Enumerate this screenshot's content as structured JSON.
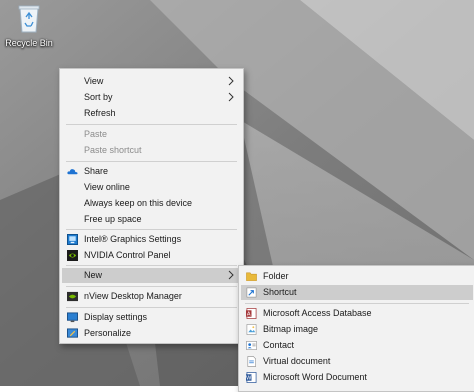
{
  "desktop": {
    "recycle_bin_label": "Recycle Bin"
  },
  "context_menu": {
    "view": "View",
    "sort_by": "Sort by",
    "refresh": "Refresh",
    "paste": "Paste",
    "paste_shortcut": "Paste shortcut",
    "share": "Share",
    "view_online": "View online",
    "always_keep": "Always keep on this device",
    "free_up_space": "Free up space",
    "intel_graphics": "Intel® Graphics Settings",
    "nvidia_panel": "NVIDIA Control Panel",
    "new": "New",
    "nview": "nView Desktop Manager",
    "display_settings": "Display settings",
    "personalize": "Personalize"
  },
  "new_submenu": {
    "folder": "Folder",
    "shortcut": "Shortcut",
    "access_db": "Microsoft Access Database",
    "bitmap": "Bitmap image",
    "contact": "Contact",
    "virtual_doc": "Virtual document",
    "word_doc": "Microsoft Word Document"
  },
  "colors": {
    "menu_bg": "#f2f2f2",
    "hover_bg": "#cdcdcd",
    "disabled_text": "#8c8c8c",
    "onedrive_blue": "#1e73d2",
    "nvidia_green": "#76b900",
    "folder_yellow": "#e8b93a",
    "access_red": "#a4373a",
    "word_blue": "#2b579a"
  }
}
